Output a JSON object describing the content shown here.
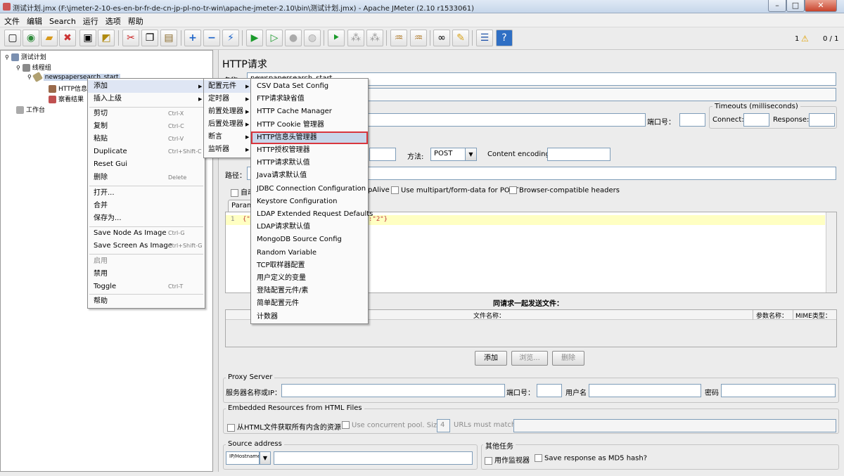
{
  "window": {
    "title": "测试计划.jmx (F:\\jmeter-2-10-es-en-br-fr-de-cn-jp-pl-no-tr-win\\apache-jmeter-2.10\\bin\\测试计划.jmx) - Apache JMeter (2.10 r1533061)",
    "minimize": "–",
    "maximize": "□",
    "close": "✕"
  },
  "menubar": [
    "文件",
    "编辑",
    "Search",
    "运行",
    "选项",
    "帮助"
  ],
  "toolbar": {
    "counter_warn": "1",
    "counter_threads": "0 / 1",
    "icons": [
      "new-icon",
      "template-icon",
      "open-icon",
      "close-file-icon",
      "save-icon",
      "save-as-icon",
      "cut-icon",
      "copy-icon",
      "paste-icon",
      "expand-icon",
      "collapse-icon",
      "toggle-icon",
      "start-icon",
      "start-no-pause-icon",
      "stop-icon",
      "shutdown-icon",
      "remote-start-icon",
      "remote-stop-icon",
      "remote-shutdown-icon",
      "clear-icon",
      "clear-all-icon",
      "search-icon",
      "reset-search-icon",
      "function-helper-icon",
      "help-icon"
    ]
  },
  "tree": {
    "nodes": [
      "测试计划",
      "线程组",
      "newspapersearch_start",
      "HTTP信息",
      "察看结果",
      "工作台"
    ]
  },
  "context_menu": {
    "items": [
      {
        "label": "添加",
        "arrow": "▶",
        "shortcut": ""
      },
      {
        "label": "插入上级",
        "arrow": "▶",
        "shortcut": ""
      },
      {
        "label": "剪切",
        "shortcut": "Ctrl-X"
      },
      {
        "label": "复制",
        "shortcut": "Ctrl-C"
      },
      {
        "label": "粘贴",
        "shortcut": "Ctrl-V"
      },
      {
        "label": "Duplicate",
        "shortcut": "Ctrl+Shift-C"
      },
      {
        "label": "Reset Gui",
        "shortcut": ""
      },
      {
        "label": "删除",
        "shortcut": "Delete"
      },
      {
        "label": "打开...",
        "shortcut": ""
      },
      {
        "label": "合并",
        "shortcut": ""
      },
      {
        "label": "保存为...",
        "shortcut": ""
      },
      {
        "label": "Save Node As Image",
        "shortcut": "Ctrl-G"
      },
      {
        "label": "Save Screen As Image",
        "shortcut": "Ctrl+Shift-G"
      },
      {
        "label": "启用",
        "shortcut": ""
      },
      {
        "label": "禁用",
        "shortcut": ""
      },
      {
        "label": "Toggle",
        "shortcut": "Ctrl-T"
      },
      {
        "label": "帮助",
        "shortcut": ""
      }
    ]
  },
  "add_submenu": {
    "items": [
      "配置元件",
      "定时器",
      "前置处理器",
      "后置处理器",
      "断言",
      "监听器"
    ]
  },
  "config_submenu": {
    "items": [
      "CSV Data Set Config",
      "FTP请求缺省值",
      "HTTP Cache Manager",
      "HTTP Cookie 管理器",
      "HTTP信息头管理器",
      "HTTP授权管理器",
      "HTTP请求默认值",
      "Java请求默认值",
      "JDBC Connection Configuration",
      "Keystore Configuration",
      "LDAP Extended Request Defaults",
      "LDAP请求默认值",
      "MongoDB Source Config",
      "Random Variable",
      "TCP取样器配置",
      "用户定义的变量",
      "登陆配置元件/素",
      "简单配置元件",
      "计数器"
    ],
    "highlighted_index": 4,
    "highlight_color": "#d9363e"
  },
  "panel": {
    "title": "HTTP请求",
    "name_label": "名称：",
    "name_value": "newspapersearch_start",
    "port_label": "端口号：",
    "timeouts_title": "Timeouts (milliseconds)",
    "connect_label": "Connect:",
    "response_label": "Response:",
    "method_label": "方法:",
    "method_value": "POST",
    "encoding_label": "Content encoding:",
    "path_label": "路径：",
    "auto_redirect": "自动",
    "keepalive": "pAlive",
    "multipart": "Use multipart/form-data for POST",
    "browser_headers": "Browser-compatible headers",
    "params_tab": "Param",
    "editor_line": "1",
    "editor_text_left": "{\"",
    "editor_text_right": ":\"2\"}",
    "files_title": "同请求一起发送文件：",
    "col_filename": "文件名称：",
    "col_param": "参数名称：",
    "col_mime": "MIME类型：",
    "btn_add": "添加",
    "btn_browse": "浏览...",
    "btn_delete": "删除",
    "proxy_title": "Proxy Server",
    "proxy_server": "服务器名称或IP：",
    "proxy_port": "端口号：",
    "proxy_user": "用户名",
    "proxy_pass": "密码",
    "embedded_title": "Embedded Resources from HTML Files",
    "embedded_all": "从HTML文件获取所有内含的资源",
    "concurrent": "Use concurrent pool. Size:",
    "pool_size": "4",
    "urls_match": "URLs must match:",
    "source_title": "Source address",
    "source_type": "IP/Hostname",
    "other_title": "其他任务",
    "monitor": "用作监视器",
    "md5": "Save response as MD5 hash?"
  }
}
